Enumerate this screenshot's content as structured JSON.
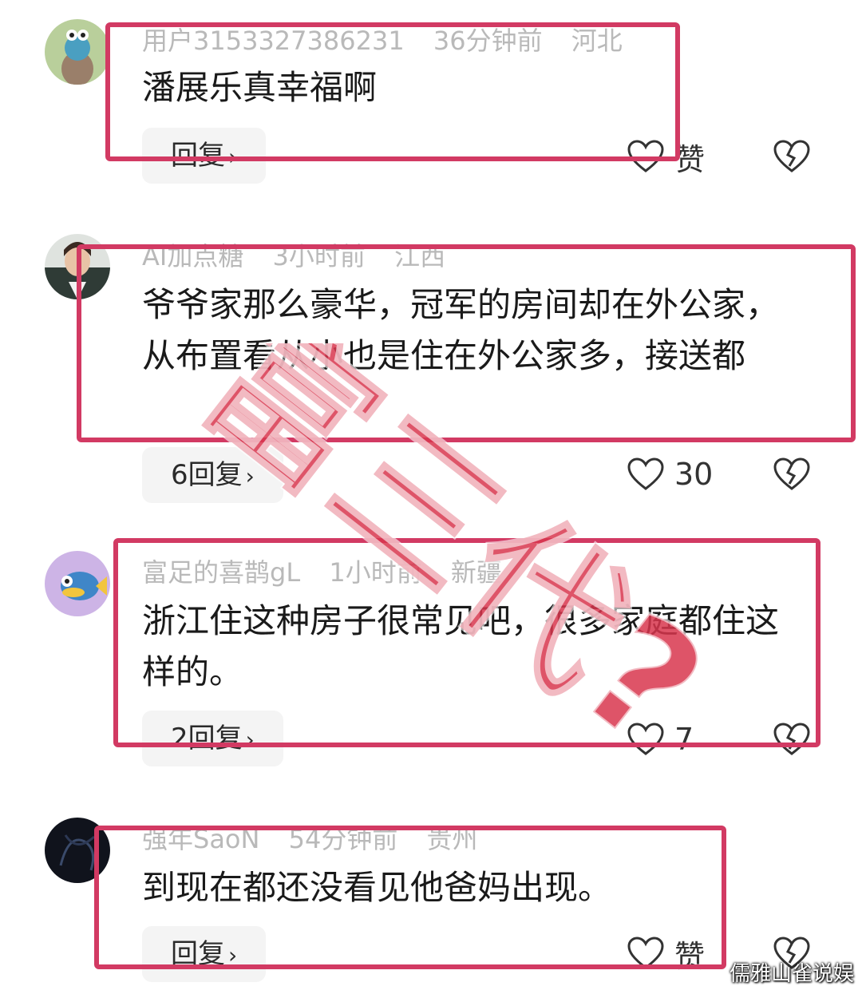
{
  "comments": [
    {
      "username": "用户3153327386231",
      "time": "36分钟前",
      "location": "河北",
      "text": "潘展乐真幸福啊",
      "reply_label": "回复",
      "like_label": "赞"
    },
    {
      "username": "AI加点糖",
      "time": "3小时前",
      "location": "江西",
      "text": "爷爷家那么豪华，冠军的房间却在外公家，从布置看从小也是住在外公家多，接送都",
      "reply_label": "6回复",
      "like_label": "30"
    },
    {
      "username": "富足的喜鹊gL",
      "time": "1小时前",
      "location": "新疆",
      "text": "浙江住这种房子很常见吧，很多家庭都住这样的。",
      "reply_label": "2回复",
      "like_label": "7"
    },
    {
      "username": "强年SaoN",
      "time": "54分钟前",
      "location": "贵州",
      "text": "到现在都还没看见他爸妈出现。",
      "reply_label": "回复",
      "like_label": "赞"
    }
  ],
  "overlay": {
    "stamp_text": "富三代?",
    "stamp_color": "#d8364e",
    "frame_color": "#d23a63"
  },
  "credit": "儒雅山雀说娱",
  "icons": {
    "chevron": "chevron-right-icon",
    "like": "heart-outline-icon",
    "dislike": "broken-heart-icon"
  }
}
